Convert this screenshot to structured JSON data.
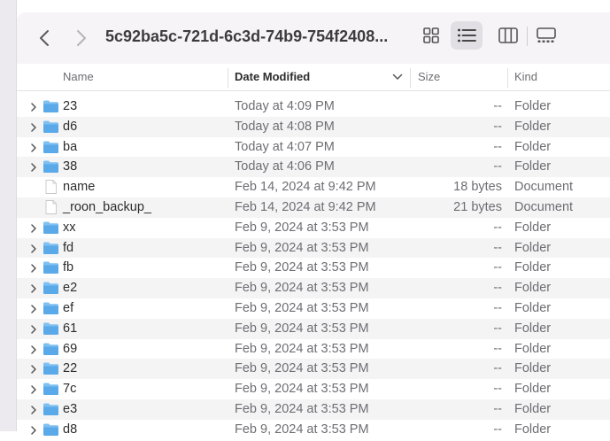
{
  "window": {
    "title": "5c92ba5c-721d-6c3d-74b9-754f2408..."
  },
  "toolbar": {
    "back_icon": "chevron-left-icon",
    "forward_icon": "chevron-right-icon",
    "views": [
      "icon-view",
      "list-view",
      "column-view",
      "gallery-view"
    ],
    "active_view": "list-view"
  },
  "columns": {
    "name": "Name",
    "date": "Date Modified",
    "size": "Size",
    "kind": "Kind",
    "sorted_by": "date"
  },
  "files": [
    {
      "name": "23",
      "date": "Today at 4:09 PM",
      "size": "--",
      "kind": "Folder",
      "type": "folder"
    },
    {
      "name": "d6",
      "date": "Today at 4:08 PM",
      "size": "--",
      "kind": "Folder",
      "type": "folder"
    },
    {
      "name": "ba",
      "date": "Today at 4:07 PM",
      "size": "--",
      "kind": "Folder",
      "type": "folder"
    },
    {
      "name": "38",
      "date": "Today at 4:06 PM",
      "size": "--",
      "kind": "Folder",
      "type": "folder"
    },
    {
      "name": "name",
      "date": "Feb 14, 2024 at 9:42 PM",
      "size": "18 bytes",
      "kind": "Document",
      "type": "document"
    },
    {
      "name": "_roon_backup_",
      "date": "Feb 14, 2024 at 9:42 PM",
      "size": "21 bytes",
      "kind": "Document",
      "type": "document"
    },
    {
      "name": "xx",
      "date": "Feb 9, 2024 at 3:53 PM",
      "size": "--",
      "kind": "Folder",
      "type": "folder"
    },
    {
      "name": "fd",
      "date": "Feb 9, 2024 at 3:53 PM",
      "size": "--",
      "kind": "Folder",
      "type": "folder"
    },
    {
      "name": "fb",
      "date": "Feb 9, 2024 at 3:53 PM",
      "size": "--",
      "kind": "Folder",
      "type": "folder"
    },
    {
      "name": "e2",
      "date": "Feb 9, 2024 at 3:53 PM",
      "size": "--",
      "kind": "Folder",
      "type": "folder"
    },
    {
      "name": "ef",
      "date": "Feb 9, 2024 at 3:53 PM",
      "size": "--",
      "kind": "Folder",
      "type": "folder"
    },
    {
      "name": "61",
      "date": "Feb 9, 2024 at 3:53 PM",
      "size": "--",
      "kind": "Folder",
      "type": "folder"
    },
    {
      "name": "69",
      "date": "Feb 9, 2024 at 3:53 PM",
      "size": "--",
      "kind": "Folder",
      "type": "folder"
    },
    {
      "name": "22",
      "date": "Feb 9, 2024 at 3:53 PM",
      "size": "--",
      "kind": "Folder",
      "type": "folder"
    },
    {
      "name": "7c",
      "date": "Feb 9, 2024 at 3:53 PM",
      "size": "--",
      "kind": "Folder",
      "type": "folder"
    },
    {
      "name": "e3",
      "date": "Feb 9, 2024 at 3:53 PM",
      "size": "--",
      "kind": "Folder",
      "type": "folder"
    },
    {
      "name": "d8",
      "date": "Feb 9, 2024 at 3:53 PM",
      "size": "--",
      "kind": "Folder",
      "type": "folder"
    }
  ],
  "colors": {
    "folder": "#5aa9e8",
    "folder_tab": "#7fc0f2",
    "row_alt": "#f4f4f5",
    "toolbar_bg": "#f7f4f8"
  }
}
